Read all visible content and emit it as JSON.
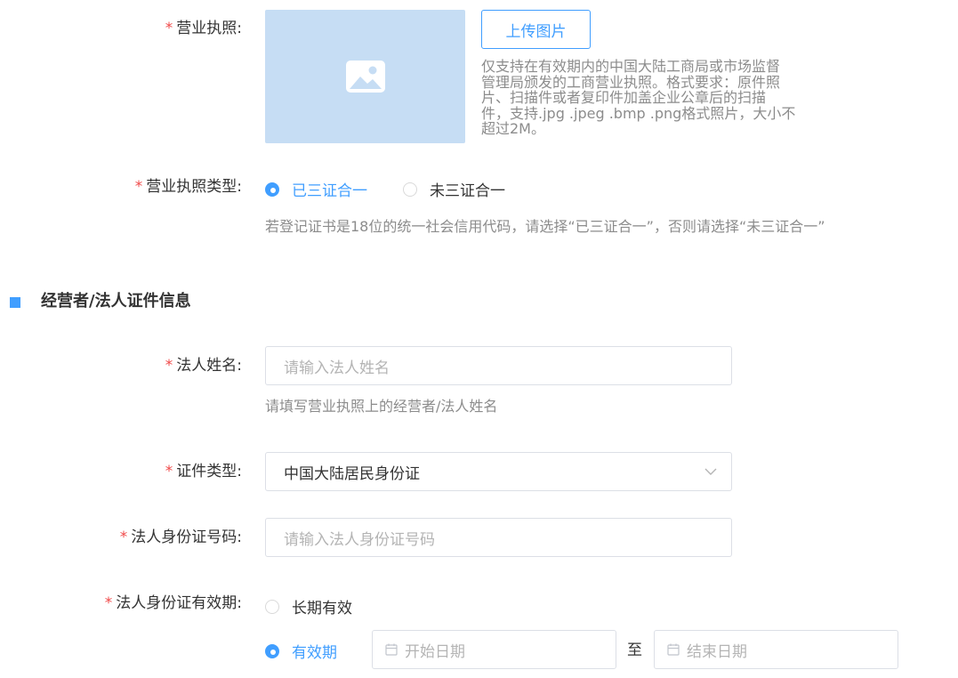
{
  "license": {
    "label": "营业执照:",
    "upload_button": "上传图片",
    "image_placeholder_icon": "image-icon",
    "description_lines": [
      "仅支持在有效期内的中国大陆工商局或市场监督",
      "管理局颁发的工商营业执照。格式要求：原件照",
      "片、扫描件或者复印件加盖企业公章后的扫描",
      "件，支持.jpg .jpeg .bmp .png格式照片，大小不",
      "超过2M。"
    ]
  },
  "license_type": {
    "label": "营业执照类型:",
    "options": [
      {
        "label": "已三证合一",
        "checked": true
      },
      {
        "label": "未三证合一",
        "checked": false
      }
    ],
    "hint": "若登记证书是18位的统一社会信用代码，请选择“已三证合一”，否则请选择“未三证合一”"
  },
  "section": {
    "title": "经营者/法人证件信息"
  },
  "legal_name": {
    "label": "法人姓名:",
    "placeholder": "请输入法人姓名",
    "hint": "请填写营业执照上的经营者/法人姓名"
  },
  "id_type": {
    "label": "证件类型:",
    "value": "中国大陆居民身份证"
  },
  "id_number": {
    "label": "法人身份证号码:",
    "placeholder": "请输入法人身份证号码"
  },
  "id_validity": {
    "label": "法人身份证有效期:",
    "options": [
      {
        "label": "长期有效",
        "checked": false
      },
      {
        "label": "有效期",
        "checked": true
      }
    ],
    "start_placeholder": "开始日期",
    "separator": "至",
    "end_placeholder": "结束日期"
  },
  "colors": {
    "accent": "#409eff",
    "required": "#f04a4a",
    "upload_box": "#c6ddf4"
  }
}
